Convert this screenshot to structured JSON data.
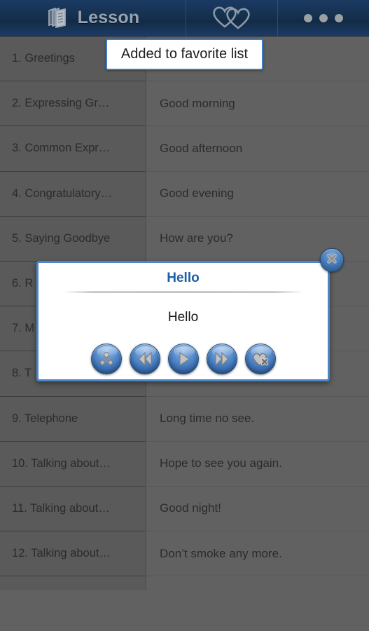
{
  "actionbar": {
    "title": "Lesson",
    "docs_icon": "documents-icon",
    "favorites_icon": "hearts-icon",
    "overflow_icon": "overflow-menu-icon"
  },
  "toast": {
    "message": "Added to favorite list"
  },
  "sidebar": {
    "items": [
      {
        "label": "1. Greetings"
      },
      {
        "label": "2. Expressing Gr…"
      },
      {
        "label": "3. Common Expr…"
      },
      {
        "label": "4. Congratulatory…"
      },
      {
        "label": "5. Saying Goodbye"
      },
      {
        "label": "6. R"
      },
      {
        "label": "7. M"
      },
      {
        "label": "8. T"
      },
      {
        "label": "9. Telephone"
      },
      {
        "label": "10. Talking about…"
      },
      {
        "label": "11. Talking about…"
      },
      {
        "label": "12. Talking about…"
      },
      {
        "label": ""
      }
    ]
  },
  "content": {
    "items": [
      {
        "label": ""
      },
      {
        "label": "Good morning"
      },
      {
        "label": "Good afternoon"
      },
      {
        "label": "Good evening"
      },
      {
        "label": "How are you?"
      },
      {
        "label": ""
      },
      {
        "label": ""
      },
      {
        "label": ""
      },
      {
        "label": "Long time no see."
      },
      {
        "label": "Hope to see you again."
      },
      {
        "label": "Good night!"
      },
      {
        "label": "Don’t smoke any more."
      }
    ]
  },
  "dialog": {
    "title": "Hello",
    "text": "Hello",
    "close_icon": "close-x-icon",
    "buttons": [
      {
        "icon": "share-icon",
        "name": "share-button"
      },
      {
        "icon": "previous-icon",
        "name": "previous-button"
      },
      {
        "icon": "play-icon",
        "name": "play-button"
      },
      {
        "icon": "next-icon",
        "name": "next-button"
      },
      {
        "icon": "remove-favorite-icon",
        "name": "remove-favorite-button"
      }
    ]
  },
  "colors": {
    "actionbar": "#15314f",
    "accent": "#4a86c8",
    "title_blue": "#1c5fa8",
    "sidebar_bg": "#5a5a5a",
    "content_bg": "#616161"
  }
}
